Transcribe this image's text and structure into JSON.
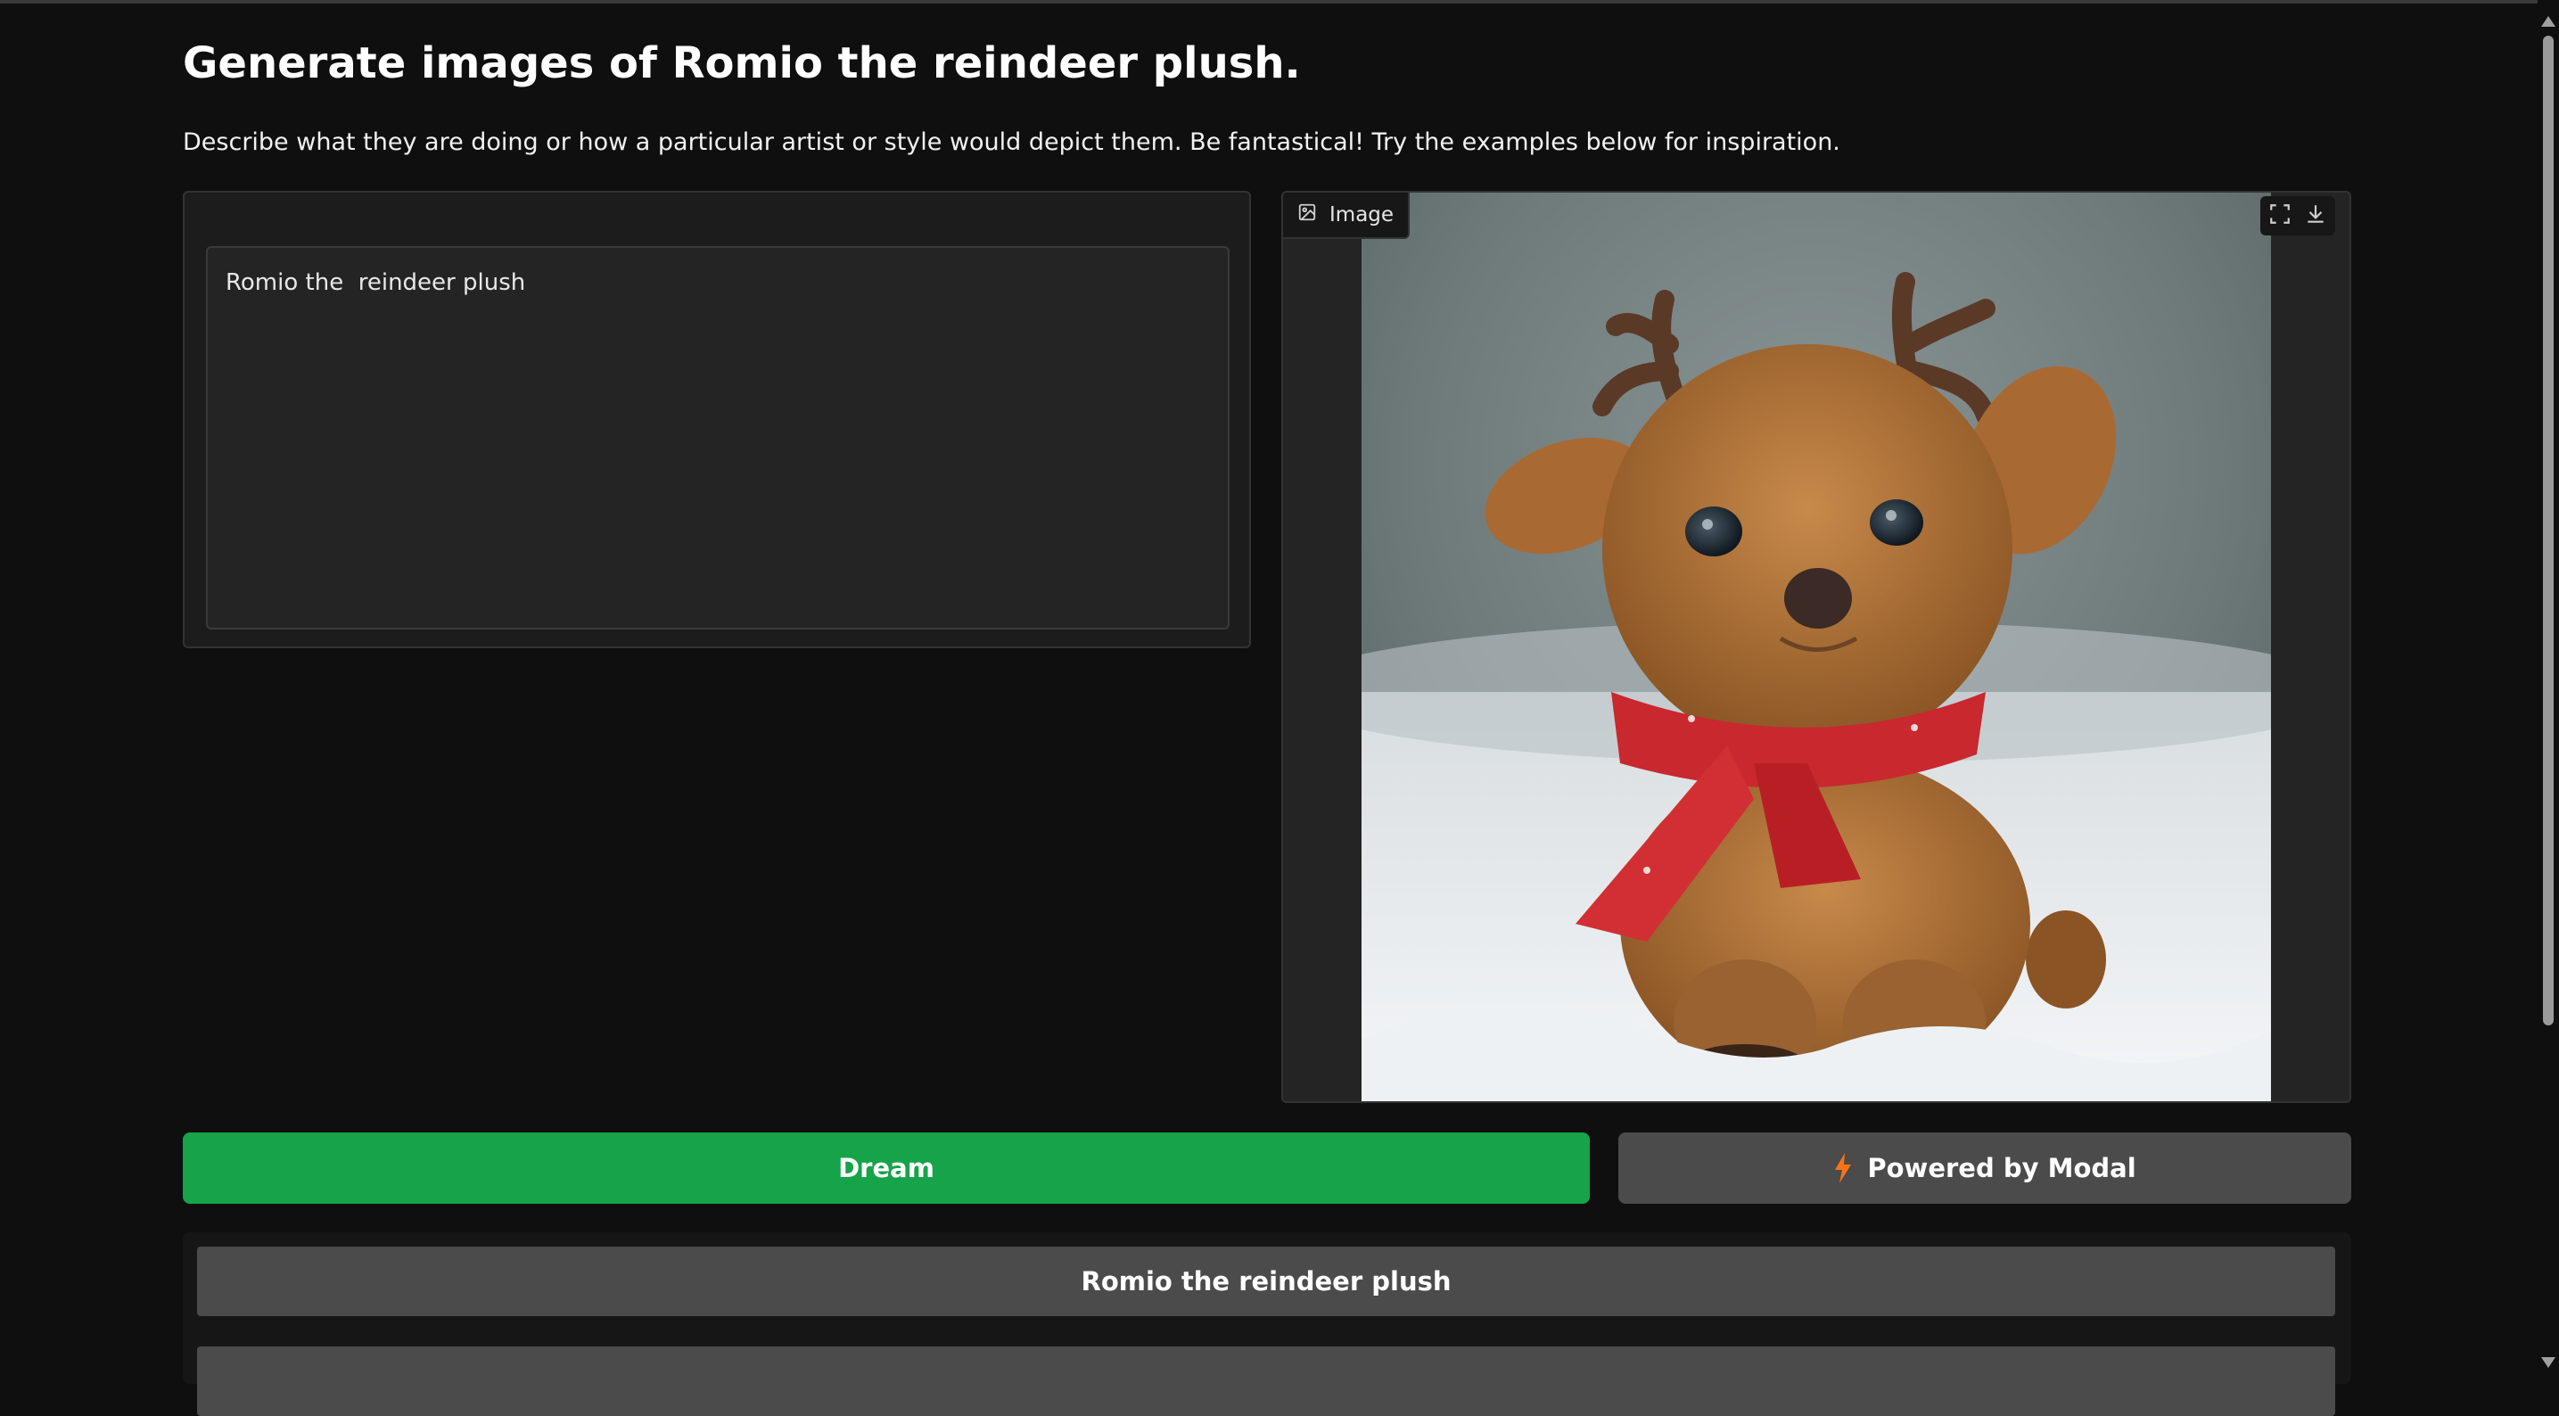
{
  "header": {
    "title": "Generate images of Romio the reindeer plush.",
    "description": "Describe what they are doing or how a particular artist or style would depict them. Be fantastical! Try the examples below for inspiration."
  },
  "prompt": {
    "value": "Romio the  reindeer plush"
  },
  "output": {
    "label": "Image",
    "icon": "image-icon",
    "fullscreen_icon": "fullscreen-icon",
    "download_icon": "download-icon"
  },
  "actions": {
    "dream_label": "Dream",
    "modal_label": "Powered by Modal",
    "modal_icon": "lightning-bolt-icon",
    "accent_color": "#16a34a",
    "bolt_color": "#f97316"
  },
  "examples": [
    {
      "label": "Romio the reindeer plush"
    },
    {
      "label": ""
    }
  ]
}
